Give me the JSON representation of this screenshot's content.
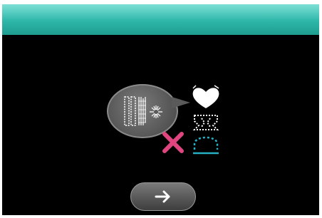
{
  "title_bar": {
    "title": ""
  },
  "icons": {
    "stitch_patterns": "stitch-patterns-icon",
    "not_allowed": "cross-icon",
    "heart_motif": "heart-motif-icon",
    "outline_motif": "outline-motif-icon",
    "arc_motif": "arc-motif-icon",
    "next": "arrow-right-icon"
  },
  "colors": {
    "title_bar": "#2db7a9",
    "cross": "#e0457f",
    "arc_motif": "#27b0c3",
    "background": "#000000"
  }
}
